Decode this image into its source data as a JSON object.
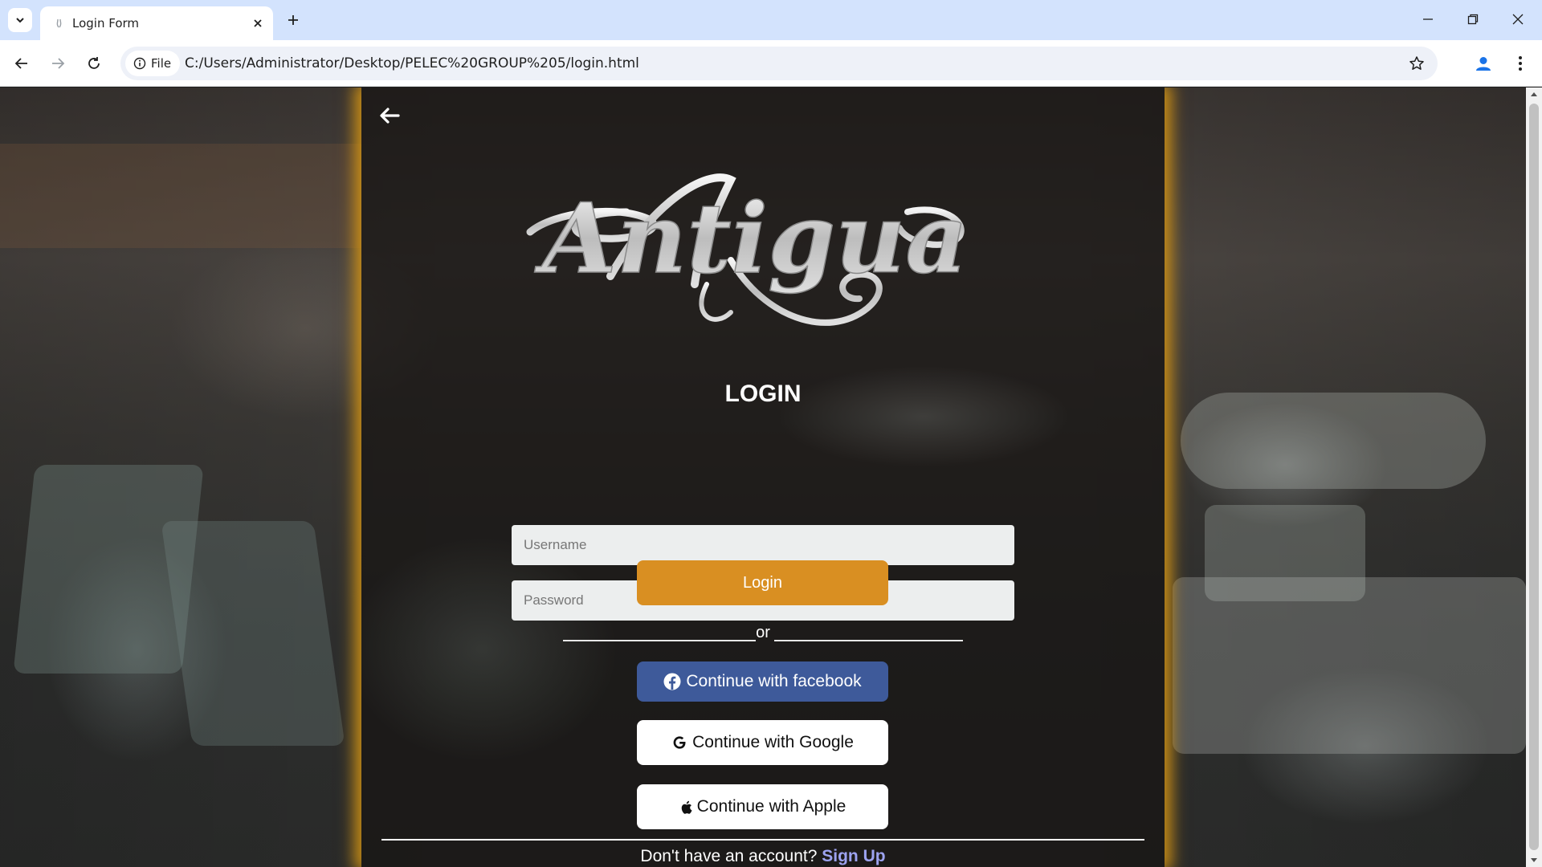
{
  "browser": {
    "tab_title": "Login Form",
    "url_chip_label": "File",
    "url": "C:/Users/Administrator/Desktop/PELEC%20GROUP%205/login.html"
  },
  "page": {
    "logo_text": "Antigua",
    "heading": "LOGIN",
    "username_placeholder": "Username",
    "password_placeholder": "Password",
    "login_button": "Login",
    "or_text": "or",
    "facebook_button": "Continue with facebook",
    "google_button": "Continue with Google",
    "apple_button": "Continue with Apple",
    "signup_prompt": "Don't have an account?",
    "signup_link": "Sign Up"
  },
  "colors": {
    "accent_orange": "#d98f22",
    "facebook_blue": "#3e5a9a",
    "signup_link": "#9da3f0",
    "panel_glow": "#d69614"
  }
}
